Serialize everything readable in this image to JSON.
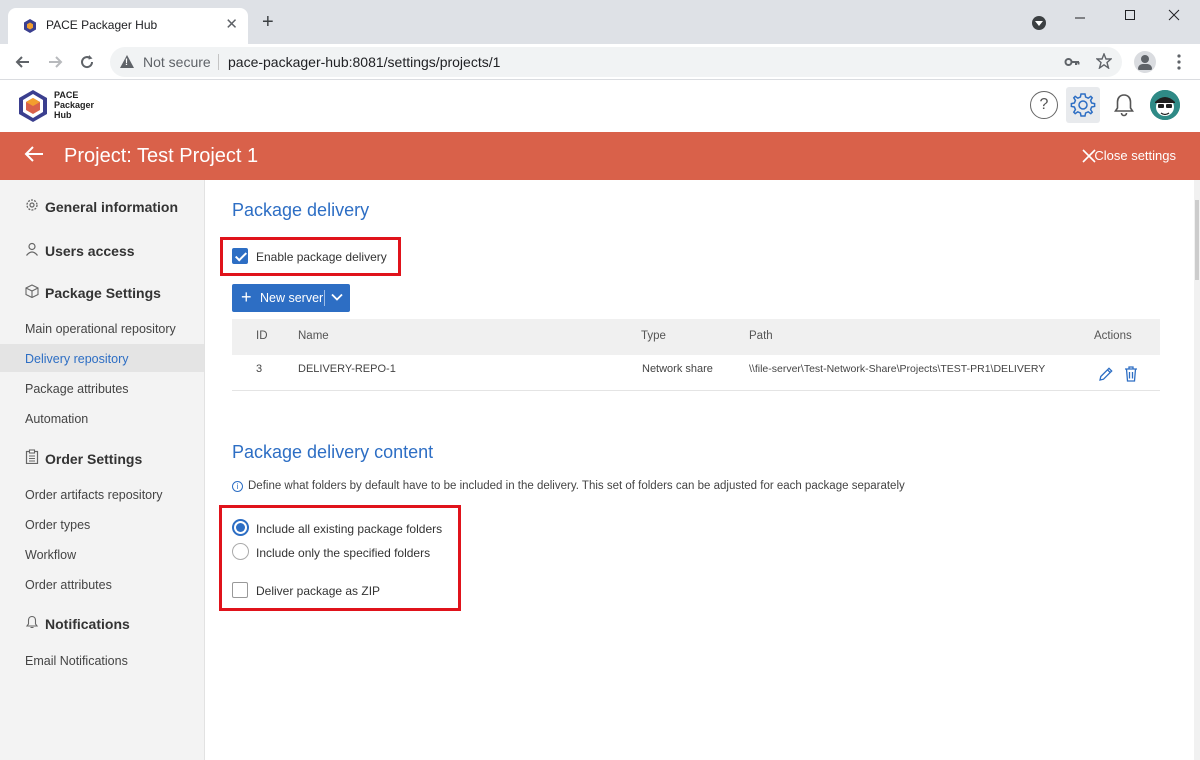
{
  "browser": {
    "tab_title": "PACE Packager Hub",
    "tab_close": "✕",
    "new_tab": "+",
    "not_secure": "Not secure",
    "url": "pace-packager-hub:8081/settings/projects/1"
  },
  "app": {
    "logo_lines": [
      "PACE",
      "Packager",
      "Hub"
    ],
    "help_glyph": "?"
  },
  "project_bar": {
    "title": "Project: Test Project 1",
    "close_label": "Close settings"
  },
  "sidebar": {
    "general_information": "General information",
    "users_access": "Users access",
    "package_settings": "Package Settings",
    "package_items": [
      "Main operational repository",
      "Delivery repository",
      "Package attributes",
      "Automation"
    ],
    "order_settings": "Order Settings",
    "order_items": [
      "Order artifacts repository",
      "Order types",
      "Workflow",
      "Order attributes"
    ],
    "notifications": "Notifications",
    "notification_items": [
      "Email Notifications"
    ],
    "active_item": "Delivery repository"
  },
  "package_delivery": {
    "title": "Package delivery",
    "enable_label": "Enable package delivery",
    "enable_checked": true,
    "new_server_label": "New server",
    "columns": [
      "ID",
      "Name",
      "Type",
      "Path",
      "Actions"
    ],
    "rows": [
      {
        "id": "3",
        "name": "DELIVERY-REPO-1",
        "type": "Network share",
        "path": "\\\\file-server\\Test-Network-Share\\Projects\\TEST-PR1\\DELIVERY"
      }
    ]
  },
  "delivery_content": {
    "title": "Package delivery content",
    "info": "Define what folders by default have to be included in the delivery. This set of folders can be adjusted for each package separately",
    "option_all": "Include all existing package folders",
    "option_specified": "Include only the specified folders",
    "selected_option": "all",
    "zip_label": "Deliver package as ZIP",
    "zip_checked": false
  },
  "colors": {
    "accent": "#2d6ec4",
    "project_bar": "#d9614a",
    "highlight": "#e0131b"
  }
}
